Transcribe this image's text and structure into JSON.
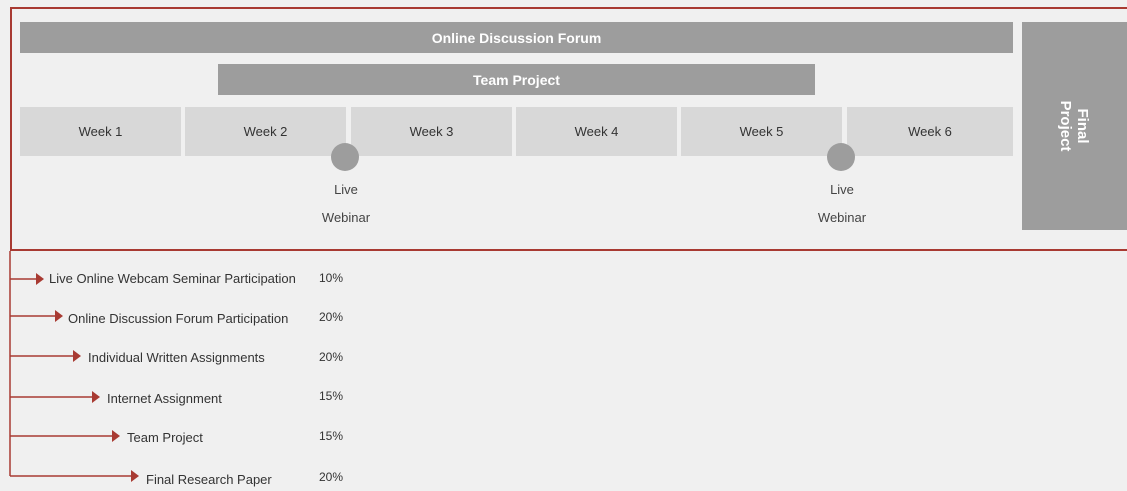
{
  "timeline": {
    "forum_bar": "Online Discussion Forum",
    "team_bar": "Team Project",
    "weeks": [
      "Week 1",
      "Week 2",
      "Week 3",
      "Week 4",
      "Week 5",
      "Week 6"
    ],
    "final_project": "Final\nProject",
    "webinars": [
      {
        "label": "Live\nWebinar"
      },
      {
        "label": "Live\nWebinar"
      }
    ]
  },
  "assessments": [
    {
      "name": "Live Online Webcam Seminar Participation",
      "percent": "10%"
    },
    {
      "name": "Online Discussion Forum Participation",
      "percent": "20%"
    },
    {
      "name": "Individual Written Assignments",
      "percent": "20%"
    },
    {
      "name": "Internet Assignment",
      "percent": "15%"
    },
    {
      "name": "Team Project",
      "percent": "15%"
    },
    {
      "name": "Final Research Paper",
      "percent": "20%"
    }
  ],
  "colors": {
    "accent": "#a83a32",
    "bar": "#9d9d9d",
    "week": "#d8d8d8",
    "background": "#f0f0f0"
  }
}
